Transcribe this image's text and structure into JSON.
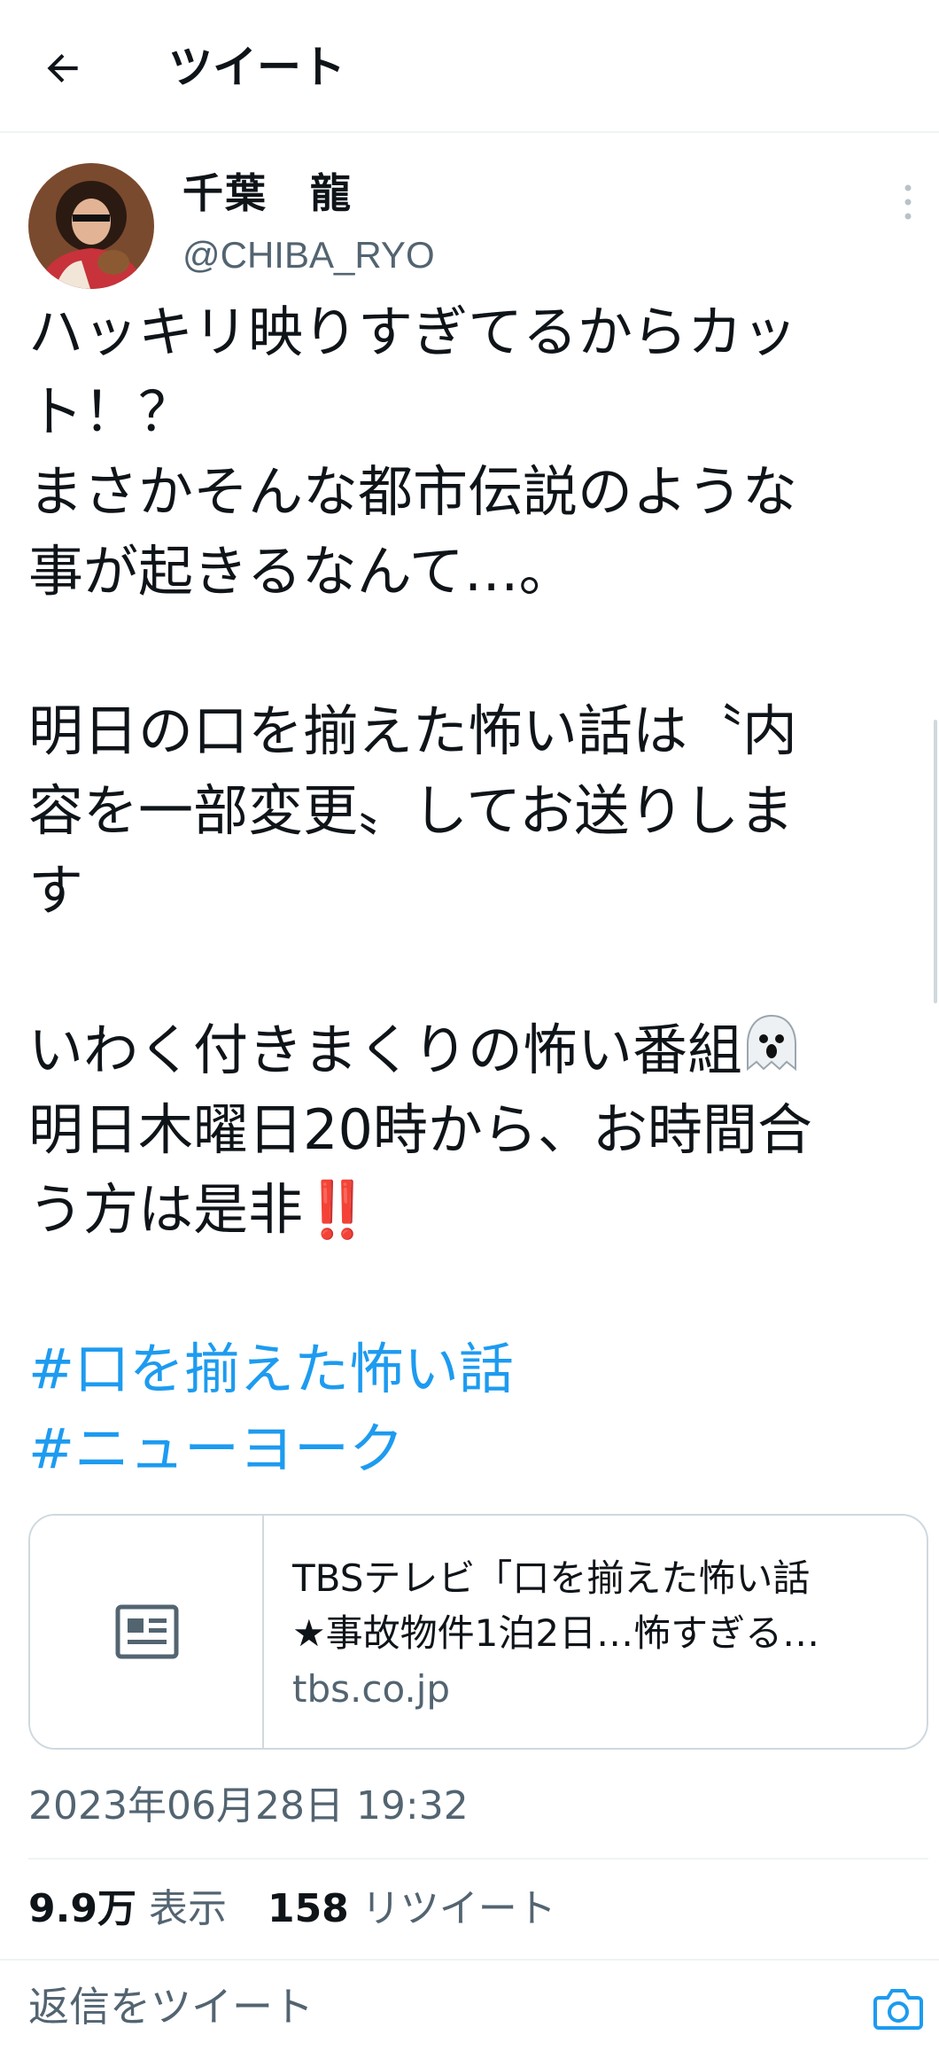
{
  "header": {
    "title": "ツイート",
    "back_icon": "arrow-left-icon"
  },
  "author": {
    "display_name": "千葉　龍",
    "handle": "@CHIBA_RYO"
  },
  "tweet": {
    "lines": [
      "ハッキリ映りすぎてるからカッ",
      "ト！？",
      "まさかそんな都市伝説のような",
      "事が起きるなんて…。",
      "",
      "明日の口を揃えた怖い話は〝内",
      "容を一部変更〟してお送りしま",
      "す",
      "",
      "いわく付きまくりの怖い番組",
      "明日木曜日20時から、お時間合",
      "う方は是非",
      ""
    ],
    "emoji_ghost": "ghost-emoji",
    "emoji_bang": "‼️",
    "hashtags": [
      "#口を揃えた怖い話",
      "#ニューヨーク"
    ]
  },
  "card": {
    "title_line1": "TBSテレビ「口を揃えた怖い話",
    "title_line2": "★事故物件1泊2日…怖すぎる…",
    "domain": "tbs.co.jp",
    "icon": "article-icon"
  },
  "timestamp": "2023年06月28日 19:32",
  "stats": {
    "views_count": "9.9万",
    "views_label": "表示",
    "retweets_count": "158",
    "retweets_label": "リツイート"
  },
  "reply": {
    "placeholder": "返信をツイート",
    "camera_icon": "camera-icon"
  },
  "colors": {
    "accent": "#1d9bf0",
    "secondary_text": "#536471",
    "border": "#cfd9de",
    "bang": "#d0202a"
  }
}
